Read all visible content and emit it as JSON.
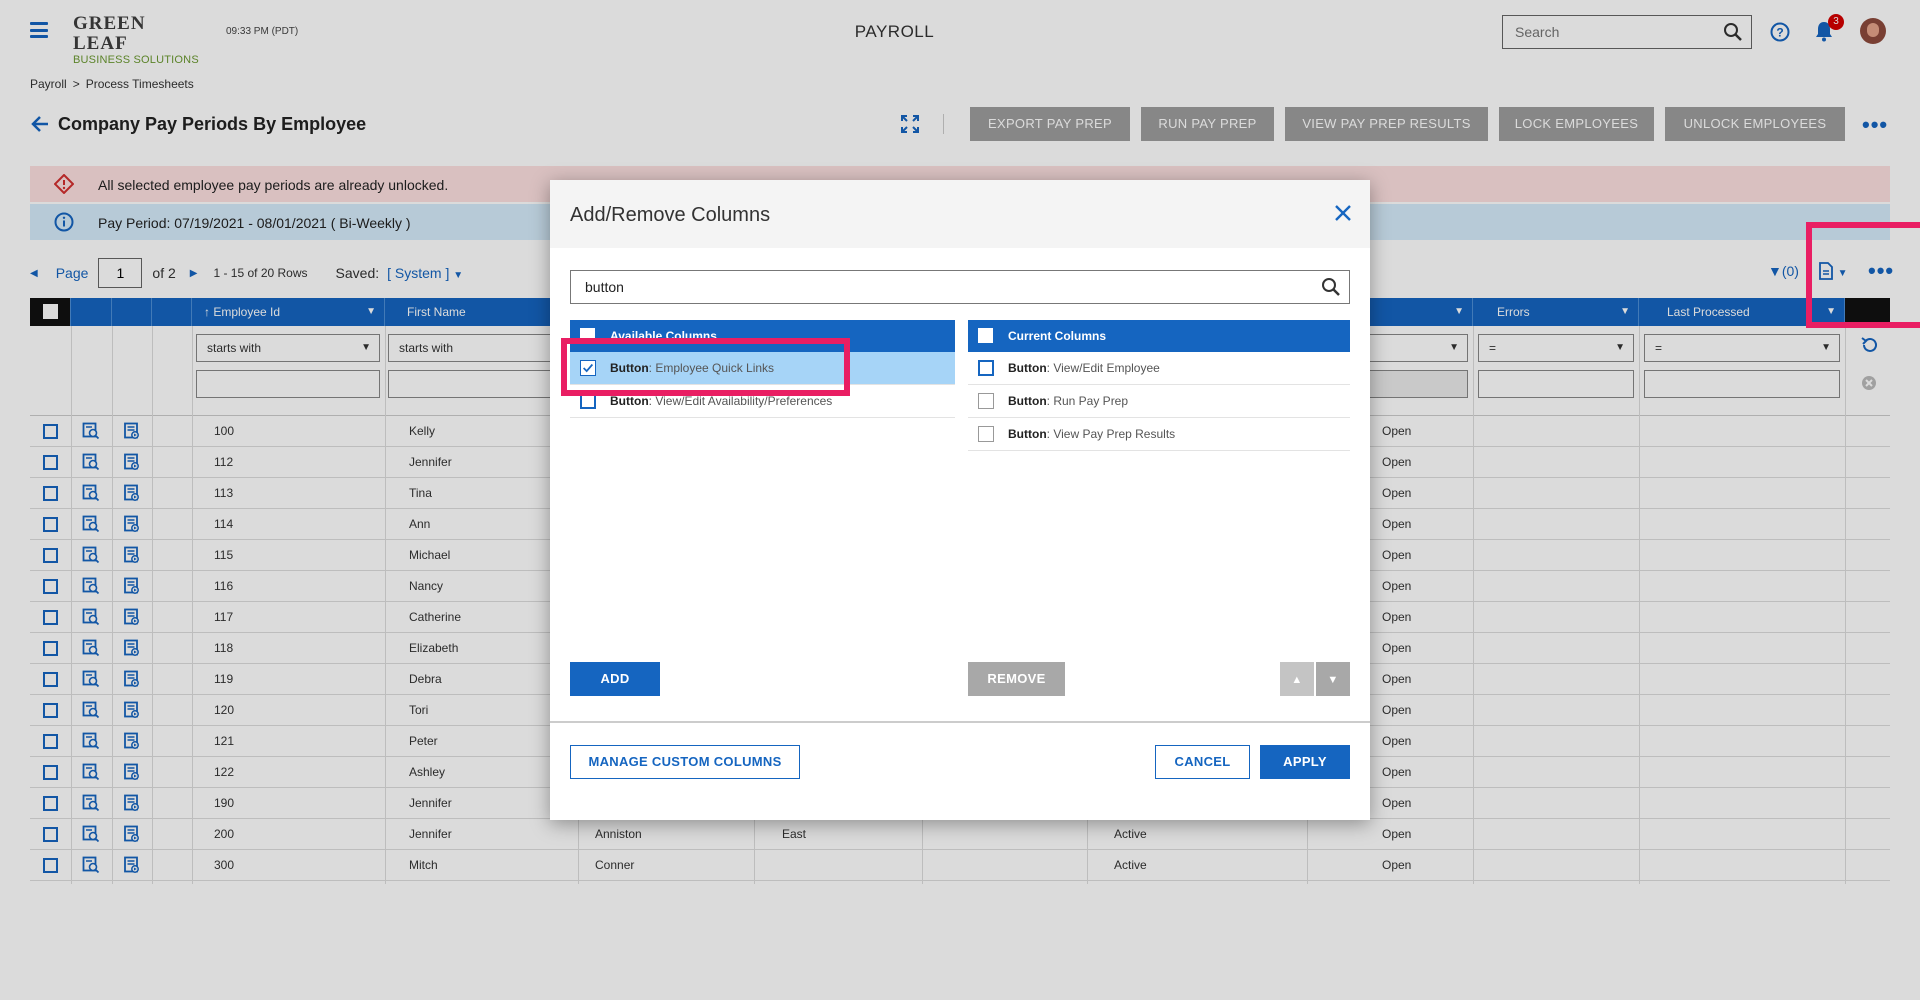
{
  "header": {
    "logo_top": "GREEN LEAF",
    "logo_bottom": "BUSINESS SOLUTIONS",
    "time": "09:33 PM (PDT)",
    "app_title": "PAYROLL",
    "search_placeholder": "Search",
    "notification_count": "3"
  },
  "breadcrumb": {
    "root": "Payroll",
    "sep": ">",
    "current": "Process Timesheets"
  },
  "page": {
    "title": "Company Pay Periods By Employee"
  },
  "actions": [
    "EXPORT PAY PREP",
    "RUN PAY PREP",
    "VIEW PAY PREP RESULTS",
    "LOCK EMPLOYEES",
    "UNLOCK EMPLOYEES"
  ],
  "alerts": {
    "error": "All selected employee pay periods are already unlocked.",
    "info": "Pay Period: 07/19/2021 - 08/01/2021 ( Bi-Weekly )"
  },
  "pager": {
    "page_label": "Page",
    "page_value": "1",
    "of_text": "of 2",
    "rows_text": "1 - 15 of 20 Rows",
    "saved_label": "Saved:",
    "saved_value": "[ System ]",
    "filter_count": "(0)"
  },
  "grid": {
    "columns": {
      "employee_id": "↑ Employee Id",
      "first_name": "First Name",
      "errors": "Errors",
      "last_processed": "Last Processed"
    },
    "filters": {
      "starts_with": "starts with",
      "equals": "="
    },
    "rows": [
      {
        "id": "100",
        "first": "Kelly",
        "last": "",
        "region": "",
        "status": "",
        "lock": "Open"
      },
      {
        "id": "112",
        "first": "Jennifer",
        "last": "",
        "region": "",
        "status": "",
        "lock": "Open"
      },
      {
        "id": "113",
        "first": "Tina",
        "last": "",
        "region": "",
        "status": "",
        "lock": "Open"
      },
      {
        "id": "114",
        "first": "Ann",
        "last": "",
        "region": "",
        "status": "",
        "lock": "Open"
      },
      {
        "id": "115",
        "first": "Michael",
        "last": "",
        "region": "",
        "status": "",
        "lock": "Open"
      },
      {
        "id": "116",
        "first": "Nancy",
        "last": "",
        "region": "",
        "status": "",
        "lock": "Open"
      },
      {
        "id": "117",
        "first": "Catherine",
        "last": "",
        "region": "",
        "status": "",
        "lock": "Open"
      },
      {
        "id": "118",
        "first": "Elizabeth",
        "last": "",
        "region": "",
        "status": "",
        "lock": "Open"
      },
      {
        "id": "119",
        "first": "Debra",
        "last": "",
        "region": "",
        "status": "",
        "lock": "Open"
      },
      {
        "id": "120",
        "first": "Tori",
        "last": "",
        "region": "",
        "status": "",
        "lock": "Open"
      },
      {
        "id": "121",
        "first": "Peter",
        "last": "",
        "region": "",
        "status": "",
        "lock": "Open"
      },
      {
        "id": "122",
        "first": "Ashley",
        "last": "",
        "region": "",
        "status": "",
        "lock": "Open"
      },
      {
        "id": "190",
        "first": "Jennifer",
        "last": "",
        "region": "",
        "status": "",
        "lock": "Open"
      },
      {
        "id": "200",
        "first": "Jennifer",
        "last": "Anniston",
        "region": "East",
        "status": "Active",
        "lock": "Open"
      },
      {
        "id": "300",
        "first": "Mitch",
        "last": "Conner",
        "region": "",
        "status": "Active",
        "lock": "Open"
      }
    ]
  },
  "modal": {
    "title": "Add/Remove Columns",
    "search_value": "button",
    "available_header": "Available Columns",
    "current_header": "Current Columns",
    "available": [
      {
        "prefix": "Button",
        "label": ": Employee Quick Links"
      },
      {
        "prefix": "Button",
        "label": ": View/Edit Availability/Preferences"
      }
    ],
    "current": [
      {
        "prefix": "Button",
        "label": ": View/Edit Employee"
      },
      {
        "prefix": "Button",
        "label": ": Run Pay Prep"
      },
      {
        "prefix": "Button",
        "label": ": View Pay Prep Results"
      }
    ],
    "add_label": "ADD",
    "remove_label": "REMOVE",
    "manage_label": "MANAGE CUSTOM COLUMNS",
    "cancel_label": "CANCEL",
    "apply_label": "APPLY"
  },
  "colors": {
    "primary": "#1565c0",
    "highlight": "#e91e63",
    "error_bg": "#fde0e0",
    "info_bg": "#d6ecfb"
  }
}
